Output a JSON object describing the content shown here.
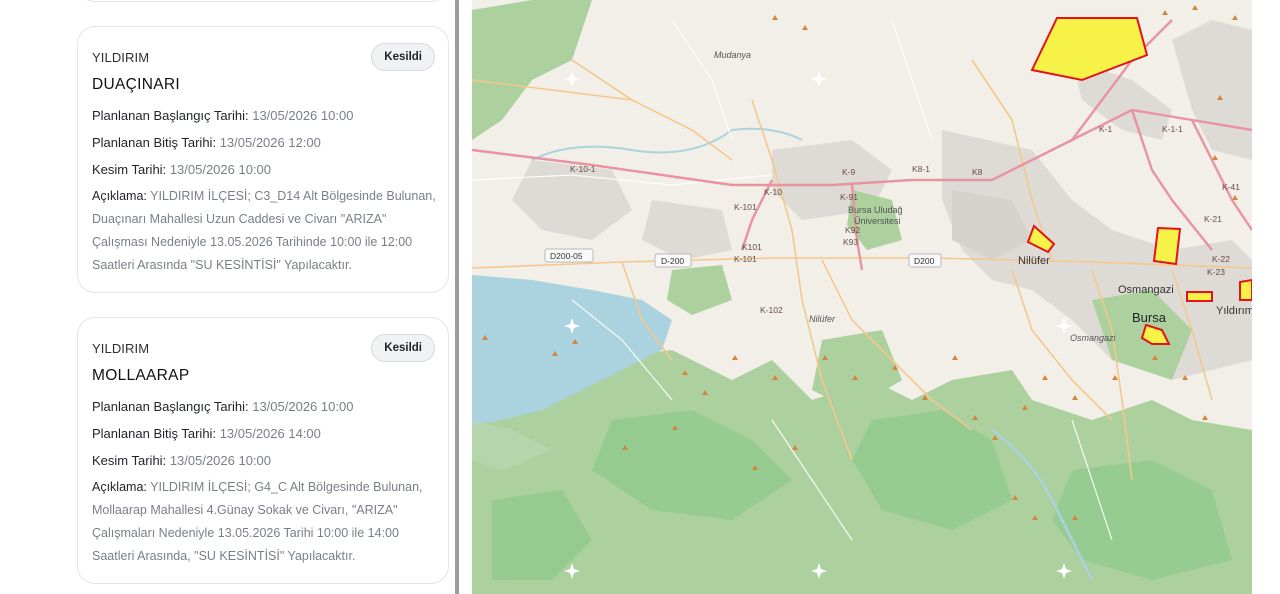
{
  "labels": {
    "start": "Planlanan Başlangıç Tarihi:",
    "end": "Planlanan Bitiş Tarihi:",
    "cut": "Kesim Tarihi:",
    "desc": "Açıklama:"
  },
  "outages": [
    {
      "district": "YILDIRIM",
      "status": "Kesildi",
      "neighborhood": "DUAÇINARI",
      "start": "13/05/2026 10:00",
      "end": "13/05/2026 12:00",
      "cut": "13/05/2026 10:00",
      "description": "YILDIRIM İLÇESİ; C3_D14 Alt Bölgesinde Bulunan, Duaçınarı Mahallesi Uzun Caddesi ve Civarı \"ARIZA\" Çalışması Nedeniyle 13.05.2026 Tarihinde 10:00 ile 12:00 Saatleri Arasında \"SU KESİNTİSİ\" Yapılacaktır."
    },
    {
      "district": "YILDIRIM",
      "status": "Kesildi",
      "neighborhood": "MOLLAARAP",
      "start": "13/05/2026 10:00",
      "end": "13/05/2026 14:00",
      "cut": "13/05/2026 10:00",
      "description": "YILDIRIM İLÇESİ; G4_C Alt Bölgesinde Bulunan, Mollaarap Mahallesi 4.Günay Sokak ve Civarı, \"ARIZA\" Çalışmaları Nedeniyle 13.05.2026 Tarihi 10:00 ile 14:00 Saatleri Arasında, \"SU KESİNTİSİ\" Yapılacaktır."
    }
  ],
  "map": {
    "place_labels": {
      "mudanya": "Mudanya",
      "nilufer": "Nilüfer",
      "nilufer2": "Nilüfer",
      "osmangazi": "Osmangazi",
      "osmangazi2": "Osmangazi",
      "bursa": "Bursa",
      "yildirim": "Yıldırım",
      "uni1": "Bursa Uludağ",
      "uni2": "Üniversitesi"
    },
    "road_shields": {
      "d200_05": "D200-05",
      "d200_a": "D-200",
      "d200_b": "D200"
    },
    "road_refs": {
      "k101a": "K-10-1",
      "k10": "K-10",
      "k101b": "K-101",
      "k9": "K-9",
      "k91": "K-91",
      "k81": "K8-1",
      "k8": "K8",
      "k1": "K-1",
      "k11": "K-1-1",
      "k41": "K-41",
      "k21": "K-21",
      "k22": "K-22",
      "k23": "K-23",
      "k92": "K92",
      "k93": "K93",
      "k101c": "K101",
      "k101d": "K-101",
      "k102": "K-102"
    },
    "colors": {
      "outage_fill": "#f7f247",
      "outage_stroke": "#e1141b",
      "water": "#aad3df",
      "forest": "#8fca8c",
      "motorway": "#e892a2"
    }
  }
}
